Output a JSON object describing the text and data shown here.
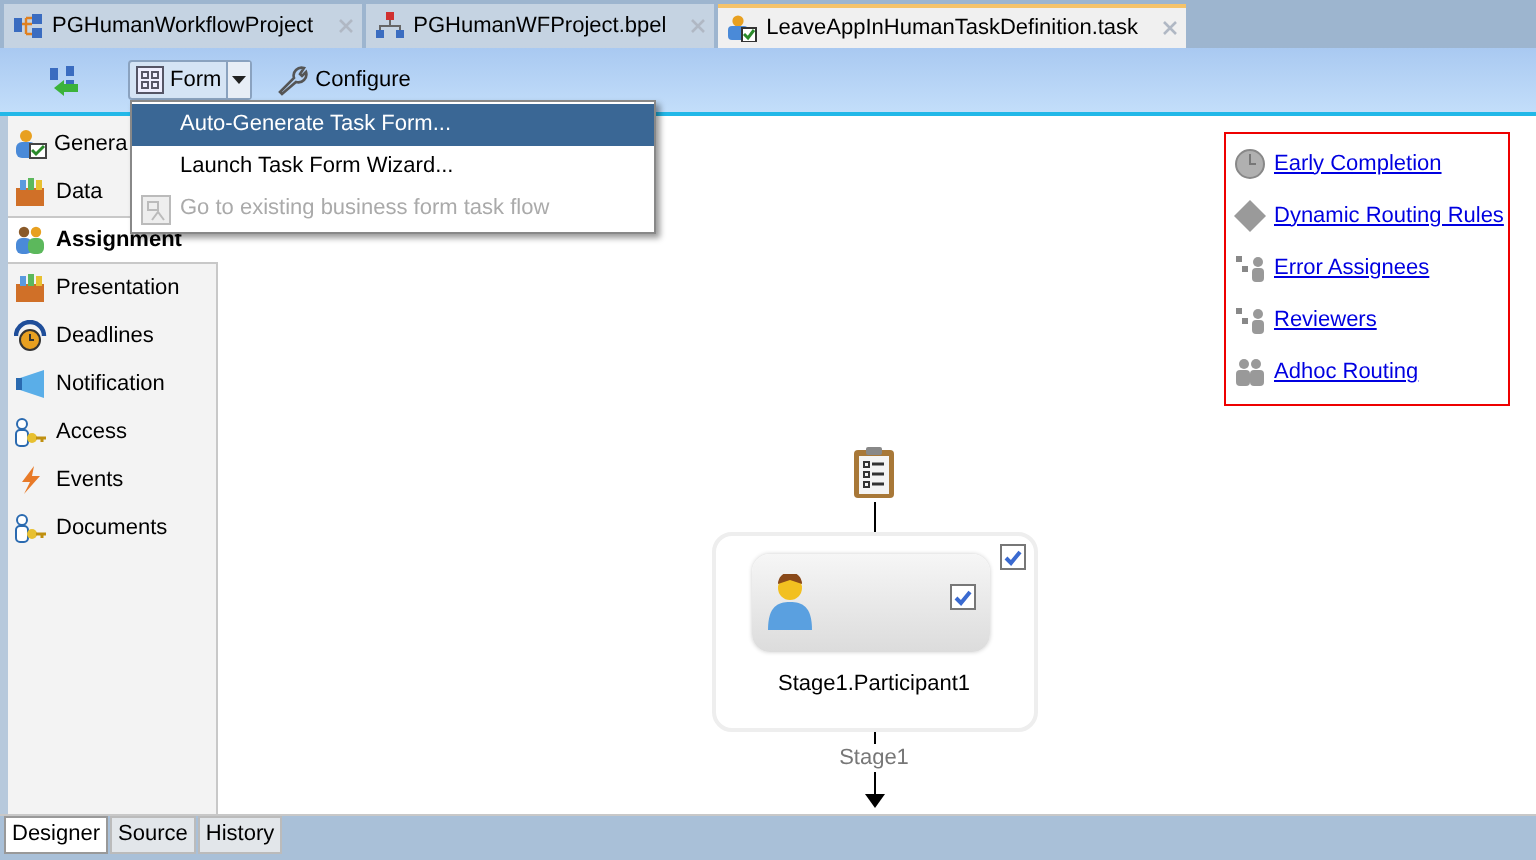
{
  "editor_tabs": [
    {
      "label": "PGHumanWorkflowProject",
      "selected": false
    },
    {
      "label": "PGHumanWFProject.bpel",
      "selected": false
    },
    {
      "label": "LeaveAppInHumanTaskDefinition.task",
      "selected": true
    }
  ],
  "toolbar": {
    "form_button": "Form",
    "configure_button": "Configure"
  },
  "form_menu": [
    {
      "label": "Auto-Generate Task Form...",
      "selected": true,
      "disabled": false
    },
    {
      "label": "Launch Task Form Wizard...",
      "selected": false,
      "disabled": false
    },
    {
      "label": "Go to existing business form task flow",
      "selected": false,
      "disabled": true
    }
  ],
  "sidebar": {
    "items": [
      {
        "label": "Genera",
        "selected": false
      },
      {
        "label": "Data",
        "selected": false
      },
      {
        "label": "Assignment",
        "selected": true
      },
      {
        "label": "Presentation",
        "selected": false
      },
      {
        "label": "Deadlines",
        "selected": false
      },
      {
        "label": "Notification",
        "selected": false
      },
      {
        "label": "Access",
        "selected": false
      },
      {
        "label": "Events",
        "selected": false
      },
      {
        "label": "Documents",
        "selected": false
      }
    ]
  },
  "links": [
    "Early Completion",
    "Dynamic Routing Rules",
    "Error Assignees",
    "Reviewers",
    "Adhoc Routing"
  ],
  "diagram": {
    "stage": {
      "label": "Stage1",
      "checked": true
    },
    "participant": {
      "label": "Stage1.Participant1",
      "checked": true
    }
  },
  "bottom_tabs": [
    {
      "label": "Designer",
      "selected": true
    },
    {
      "label": "Source",
      "selected": false
    },
    {
      "label": "History",
      "selected": false
    }
  ]
}
